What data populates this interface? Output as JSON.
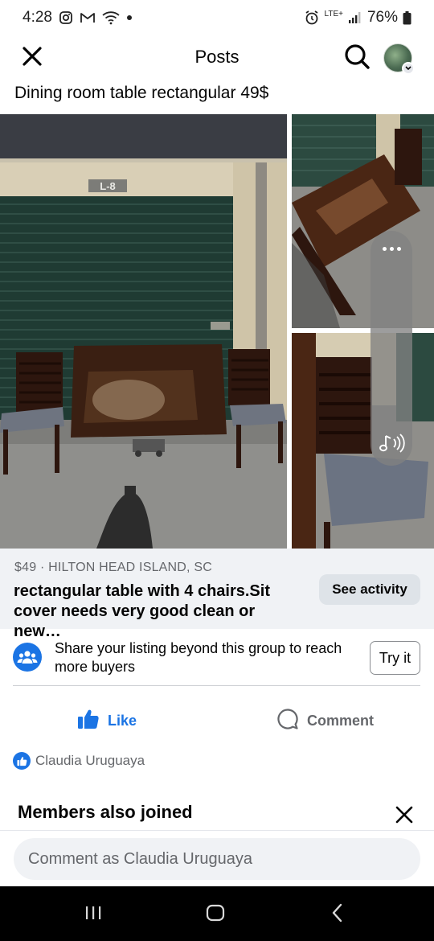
{
  "status_bar": {
    "time": "4:28",
    "network": "LTE+",
    "battery": "76%",
    "icons": [
      "instagram-icon",
      "gmail-icon",
      "wifi-icon",
      "dot-icon",
      "alarm-icon",
      "signal-icon",
      "battery-icon"
    ]
  },
  "header": {
    "title": "Posts",
    "icons": [
      "close-icon",
      "search-icon",
      "avatar"
    ]
  },
  "post": {
    "title": "Dining room table rectangular 49$",
    "photos": {
      "main_sign": "L-8"
    }
  },
  "listing": {
    "price_location": "$49 · HILTON HEAD ISLAND, SC",
    "description": "rectangular table with 4 chairs.Sit cover needs very good clean or new…",
    "see_activity_label": "See activity"
  },
  "share": {
    "text": "Share your listing beyond this group to reach more buyers",
    "button_label": "Try it"
  },
  "actions": {
    "like_label": "Like",
    "comment_label": "Comment"
  },
  "reactions": {
    "name": "Claudia Uruguaya"
  },
  "members": {
    "heading": "Members also joined"
  },
  "comment_box": {
    "placeholder": "Comment as Claudia Uruguaya"
  },
  "colors": {
    "accent": "#1b74e4",
    "secondary_text": "#65676b",
    "panel_bg": "#f0f2f5"
  }
}
